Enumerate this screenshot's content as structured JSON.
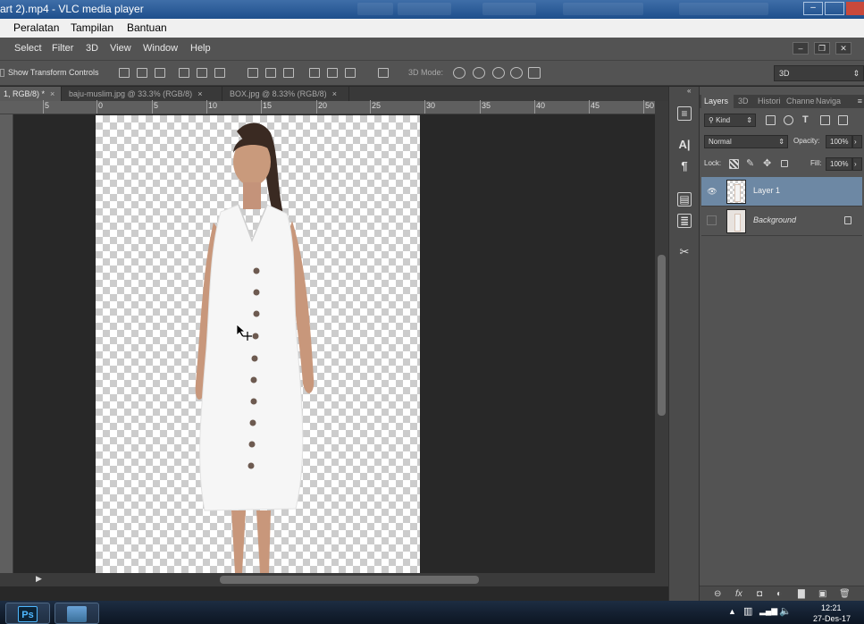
{
  "vlc": {
    "title": "art 2).mp4 - VLC media player",
    "menu": [
      "Peralatan",
      "Tampilan",
      "Bantuan"
    ]
  },
  "ps": {
    "menu": [
      "Select",
      "Filter",
      "3D",
      "View",
      "Window",
      "Help"
    ],
    "options": {
      "show_transform_controls": "Show Transform Controls",
      "three_d_mode_label": "3D Mode:",
      "workspace_select": "3D"
    },
    "doc_tabs": [
      {
        "label": "1, RGB/8) *",
        "close": "×",
        "active": true
      },
      {
        "label": "baju-muslim.jpg @ 33.3% (RGB/8)",
        "close": "×",
        "active": false
      },
      {
        "label": "BOX.jpg @ 8.33% (RGB/8)",
        "close": "×",
        "active": false
      }
    ],
    "ruler_numbers": [
      "5",
      "0",
      "5",
      "10",
      "15",
      "20",
      "25",
      "30",
      "35",
      "40",
      "45",
      "50"
    ],
    "layers_panel": {
      "tabs": [
        "Layers",
        "3D",
        "Histori",
        "Channe",
        "Naviga"
      ],
      "kind_filter": "Kind",
      "blend_mode": "Normal",
      "opacity_label": "Opacity:",
      "opacity_value": "100%",
      "lock_label": "Lock:",
      "fill_label": "Fill:",
      "fill_value": "100%",
      "layers": [
        {
          "name": "Layer 1",
          "visible": true,
          "active": true,
          "locked": false
        },
        {
          "name": "Background",
          "visible": false,
          "active": false,
          "locked": true
        }
      ]
    }
  },
  "taskbar": {
    "ps_icon": "Ps",
    "time": "12:21",
    "date": "27-Des-17"
  },
  "colors": {
    "accent_layer_selected": "#6d88a4",
    "vlc_title_bg": "#1e4f8c",
    "ps_panel_bg": "#535353",
    "workspace_bg": "#282828"
  }
}
